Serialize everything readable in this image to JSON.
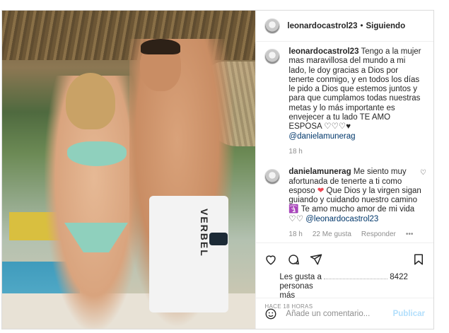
{
  "header": {
    "username": "leonardocastrol23",
    "separator": "•",
    "follow_status": "Siguiendo"
  },
  "photo": {
    "shorts_text": "VERBEL"
  },
  "caption": {
    "username": "leonardocastrol23",
    "text": "Tengo a la mujer mas maravillosa del mundo a mi lado, le doy gracias a Dios por tenerte conmigo, y en todos los días le pido a Dios que estemos juntos y para que cumplamos todas nuestras metas y lo más importante es envejecer a tu lado TE AMO ESPOSA ♡♡♡♥",
    "mention": "@danielamunerag",
    "time": "18 h"
  },
  "comment": {
    "username": "danielamunerag",
    "text_1": "Me siento muy afortunada de tenerte a ti como esposo",
    "heart": "❤",
    "text_2": "Que Dios y la virgen sigan guiando y cuidando nuestro camino",
    "emoji_2": "🛐",
    "text_3": "Te amo mucho amor de mi vida",
    "emoji_3": "♡♡",
    "mention": "@leonardocastrol23",
    "time": "18 h",
    "likes": "22 Me gusta",
    "reply": "Responder",
    "more": "•••"
  },
  "actions": {
    "likes_prefix": "Les gusta a",
    "likes_count": "8422 personas",
    "likes_suffix": "más",
    "posted": "HACE 18 HORAS"
  },
  "add_comment": {
    "placeholder": "Añade un comentario...",
    "post_label": "Publicar"
  },
  "icons": [
    "heart-icon",
    "comment-icon",
    "share-icon",
    "bookmark-icon",
    "emoji-icon",
    "more-icon"
  ]
}
